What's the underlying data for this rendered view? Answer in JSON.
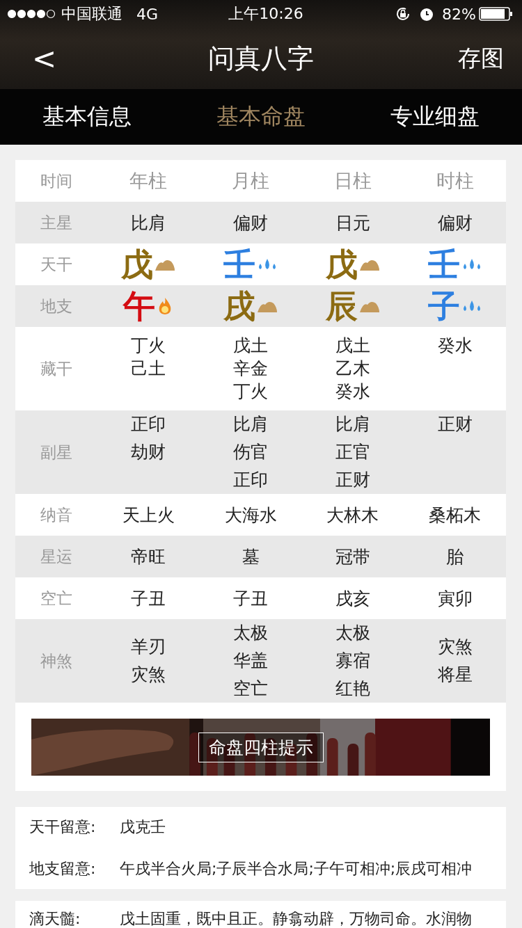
{
  "status_bar": {
    "carrier": "中国联通",
    "network": "4G",
    "time": "上午10:26",
    "battery": "82%"
  },
  "nav": {
    "back": "<",
    "title": "问真八字",
    "action": "存图"
  },
  "tabs": [
    {
      "label": "基本信息",
      "selected": false
    },
    {
      "label": "基本命盘",
      "selected": true
    },
    {
      "label": "专业细盘",
      "selected": false
    }
  ],
  "table": {
    "header": {
      "label": "时间",
      "columns": [
        "年柱",
        "月柱",
        "日柱",
        "时柱"
      ]
    },
    "rows": [
      {
        "label": "主星",
        "kind": "text",
        "cells": [
          "比肩",
          "偏财",
          "日元",
          "偏财"
        ]
      },
      {
        "label": "天干",
        "kind": "stem",
        "cells": [
          {
            "char": "戊",
            "kind": "earth"
          },
          {
            "char": "壬",
            "kind": "water"
          },
          {
            "char": "戊",
            "kind": "earth"
          },
          {
            "char": "壬",
            "kind": "water"
          }
        ]
      },
      {
        "label": "地支",
        "kind": "stem",
        "cells": [
          {
            "char": "午",
            "kind": "fire"
          },
          {
            "char": "戌",
            "kind": "earth"
          },
          {
            "char": "辰",
            "kind": "earth"
          },
          {
            "char": "子",
            "kind": "water"
          }
        ]
      },
      {
        "label": "藏干",
        "kind": "list",
        "cells": [
          [
            "丁火",
            "己土"
          ],
          [
            "戊土",
            "辛金",
            "丁火"
          ],
          [
            "戊土",
            "乙木",
            "癸水"
          ],
          [
            "癸水"
          ]
        ]
      },
      {
        "label": "副星",
        "kind": "list",
        "cells": [
          [
            "正印",
            "劫财"
          ],
          [
            "比肩",
            "伤官",
            "正印"
          ],
          [
            "比肩",
            "正官",
            "正财"
          ],
          [
            "正财"
          ]
        ]
      },
      {
        "label": "纳音",
        "kind": "text",
        "cells": [
          "天上火",
          "大海水",
          "大林木",
          "桑柘木"
        ]
      },
      {
        "label": "星运",
        "kind": "text",
        "cells": [
          "帝旺",
          "墓",
          "冠带",
          "胎"
        ]
      },
      {
        "label": "空亡",
        "kind": "text",
        "cells": [
          "子丑",
          "子丑",
          "戌亥",
          "寅卯"
        ]
      },
      {
        "label": "神煞",
        "kind": "centered-list",
        "cells": [
          [
            "羊刃",
            "灾煞"
          ],
          [
            "太极",
            "华盖",
            "空亡"
          ],
          [
            "太极",
            "寡宿",
            "红艳"
          ],
          [
            "灾煞",
            "将星"
          ]
        ]
      }
    ]
  },
  "banner": {
    "kind": "picture",
    "button": "命盘四柱提示"
  },
  "notes": [
    {
      "label": "天干留意:",
      "text": "戊克壬"
    },
    {
      "label": "地支留意:",
      "text": "午戌半合火局;子辰半合水局;子午可相冲;辰戌可相冲"
    }
  ],
  "classic": {
    "label": "滴天髓:",
    "text": "戊土固重，既中且正。静翕动辟，万物司命。水润物"
  }
}
